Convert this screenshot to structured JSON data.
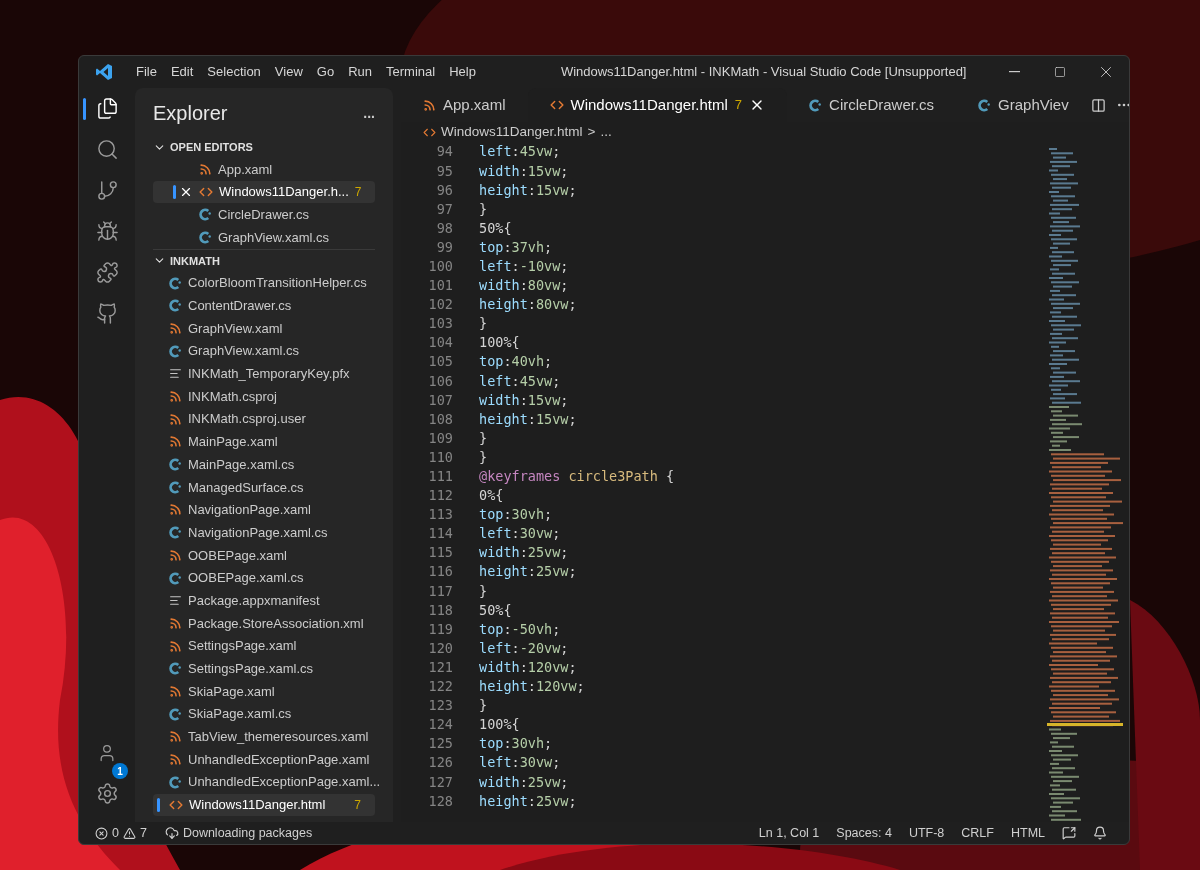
{
  "window": {
    "title": "Windows11Danger.html - INKMath - Visual Studio Code [Unsupported]"
  },
  "menu": [
    "File",
    "Edit",
    "Selection",
    "View",
    "Go",
    "Run",
    "Terminal",
    "Help"
  ],
  "activity_bar": {
    "top": [
      {
        "kind": "files",
        "selected": true
      },
      {
        "kind": "search",
        "selected": false
      },
      {
        "kind": "source-control",
        "selected": false
      },
      {
        "kind": "debug",
        "selected": false
      },
      {
        "kind": "extensions",
        "selected": false
      },
      {
        "kind": "github",
        "selected": false
      }
    ],
    "bottom": [
      {
        "kind": "account",
        "badge": "1"
      },
      {
        "kind": "settings"
      }
    ]
  },
  "sidebar": {
    "title": "Explorer",
    "more": "...",
    "sections": [
      {
        "title": "OPEN EDITORS",
        "expanded": true,
        "items": [
          {
            "name": "App.xaml",
            "kind": "xaml",
            "selected": false
          },
          {
            "name": "Windows11Danger.h...",
            "kind": "html",
            "selected": true,
            "badge": "7"
          },
          {
            "name": "CircleDrawer.cs",
            "kind": "cs",
            "selected": false
          },
          {
            "name": "GraphView.xaml.cs",
            "kind": "cs",
            "selected": false
          }
        ]
      },
      {
        "title": "INKMATH",
        "expanded": true,
        "items": [
          {
            "name": "ColorBloomTransitionHelper.cs",
            "kind": "cs",
            "selected": false
          },
          {
            "name": "ContentDrawer.cs",
            "kind": "cs",
            "selected": false
          },
          {
            "name": "GraphView.xaml",
            "kind": "xaml",
            "selected": false
          },
          {
            "name": "GraphView.xaml.cs",
            "kind": "cs",
            "selected": false
          },
          {
            "name": "INKMath_TemporaryKey.pfx",
            "kind": "text",
            "selected": false
          },
          {
            "name": "INKMath.csproj",
            "kind": "xaml",
            "selected": false
          },
          {
            "name": "INKMath.csproj.user",
            "kind": "xaml",
            "selected": false
          },
          {
            "name": "MainPage.xaml",
            "kind": "xaml",
            "selected": false
          },
          {
            "name": "MainPage.xaml.cs",
            "kind": "cs",
            "selected": false
          },
          {
            "name": "ManagedSurface.cs",
            "kind": "cs",
            "selected": false
          },
          {
            "name": "NavigationPage.xaml",
            "kind": "xaml",
            "selected": false
          },
          {
            "name": "NavigationPage.xaml.cs",
            "kind": "cs",
            "selected": false
          },
          {
            "name": "OOBEPage.xaml",
            "kind": "xaml",
            "selected": false
          },
          {
            "name": "OOBEPage.xaml.cs",
            "kind": "cs",
            "selected": false
          },
          {
            "name": "Package.appxmanifest",
            "kind": "text",
            "selected": false
          },
          {
            "name": "Package.StoreAssociation.xml",
            "kind": "xaml",
            "selected": false
          },
          {
            "name": "SettingsPage.xaml",
            "kind": "xaml",
            "selected": false
          },
          {
            "name": "SettingsPage.xaml.cs",
            "kind": "cs",
            "selected": false
          },
          {
            "name": "SkiaPage.xaml",
            "kind": "xaml",
            "selected": false
          },
          {
            "name": "SkiaPage.xaml.cs",
            "kind": "cs",
            "selected": false
          },
          {
            "name": "TabView_themeresources.xaml",
            "kind": "xaml",
            "selected": false
          },
          {
            "name": "UnhandledExceptionPage.xaml",
            "kind": "xaml",
            "selected": false
          },
          {
            "name": "UnhandledExceptionPage.xaml...",
            "kind": "cs",
            "selected": false
          },
          {
            "name": "Windows11Danger.html",
            "kind": "html",
            "selected": true,
            "badge": "7"
          }
        ]
      }
    ]
  },
  "tabs": [
    {
      "label": "App.xaml",
      "kind": "xaml",
      "selected": false
    },
    {
      "label": "Windows11Danger.html",
      "kind": "html",
      "selected": true,
      "badge": "7"
    },
    {
      "label": "CircleDrawer.cs",
      "kind": "cs",
      "selected": false
    },
    {
      "label": "GraphViev",
      "kind": "cs",
      "selected": false
    }
  ],
  "breadcrumb": {
    "file": "Windows11Danger.html",
    "separator": ">",
    "rest": "..."
  },
  "editor": {
    "lines": [
      {
        "number": "94",
        "tokens": [
          {
            "text": "left",
            "kind": "property"
          },
          {
            "text": ":",
            "kind": "punct"
          },
          {
            "text": "45vw",
            "kind": "value"
          },
          {
            "text": ";",
            "kind": "punct"
          }
        ]
      },
      {
        "number": "95",
        "tokens": [
          {
            "text": "width",
            "kind": "property"
          },
          {
            "text": ":",
            "kind": "punct"
          },
          {
            "text": "15vw",
            "kind": "value"
          },
          {
            "text": ";",
            "kind": "punct"
          }
        ]
      },
      {
        "number": "96",
        "tokens": [
          {
            "text": "height",
            "kind": "property"
          },
          {
            "text": ":",
            "kind": "punct"
          },
          {
            "text": "15vw",
            "kind": "value"
          },
          {
            "text": ";",
            "kind": "punct"
          }
        ]
      },
      {
        "number": "97",
        "tokens": [
          {
            "text": "}",
            "kind": "punct"
          }
        ]
      },
      {
        "number": "98",
        "tokens": [
          {
            "text": "50%{",
            "kind": "punct"
          }
        ]
      },
      {
        "number": "99",
        "tokens": [
          {
            "text": "top",
            "kind": "property"
          },
          {
            "text": ":",
            "kind": "punct"
          },
          {
            "text": "37vh",
            "kind": "value"
          },
          {
            "text": ";",
            "kind": "punct"
          }
        ]
      },
      {
        "number": "100",
        "tokens": [
          {
            "text": "left",
            "kind": "property"
          },
          {
            "text": ":",
            "kind": "punct"
          },
          {
            "text": "-10vw",
            "kind": "value"
          },
          {
            "text": ";",
            "kind": "punct"
          }
        ]
      },
      {
        "number": "101",
        "tokens": [
          {
            "text": "width",
            "kind": "property"
          },
          {
            "text": ":",
            "kind": "punct"
          },
          {
            "text": "80vw",
            "kind": "value"
          },
          {
            "text": ";",
            "kind": "punct"
          }
        ]
      },
      {
        "number": "102",
        "tokens": [
          {
            "text": "height",
            "kind": "property"
          },
          {
            "text": ":",
            "kind": "punct"
          },
          {
            "text": "80vw",
            "kind": "value"
          },
          {
            "text": ";",
            "kind": "punct"
          }
        ]
      },
      {
        "number": "103",
        "tokens": [
          {
            "text": "}",
            "kind": "punct"
          }
        ]
      },
      {
        "number": "104",
        "tokens": [
          {
            "text": "100%{",
            "kind": "punct"
          }
        ]
      },
      {
        "number": "105",
        "tokens": [
          {
            "text": "top",
            "kind": "property"
          },
          {
            "text": ":",
            "kind": "punct"
          },
          {
            "text": "40vh",
            "kind": "value"
          },
          {
            "text": ";",
            "kind": "punct"
          }
        ]
      },
      {
        "number": "106",
        "tokens": [
          {
            "text": "left",
            "kind": "property"
          },
          {
            "text": ":",
            "kind": "punct"
          },
          {
            "text": "45vw",
            "kind": "value"
          },
          {
            "text": ";",
            "kind": "punct"
          }
        ]
      },
      {
        "number": "107",
        "tokens": [
          {
            "text": "width",
            "kind": "property"
          },
          {
            "text": ":",
            "kind": "punct"
          },
          {
            "text": "15vw",
            "kind": "value"
          },
          {
            "text": ";",
            "kind": "punct"
          }
        ]
      },
      {
        "number": "108",
        "tokens": [
          {
            "text": "height",
            "kind": "property"
          },
          {
            "text": ":",
            "kind": "punct"
          },
          {
            "text": "15vw",
            "kind": "value"
          },
          {
            "text": ";",
            "kind": "punct"
          }
        ]
      },
      {
        "number": "109",
        "tokens": [
          {
            "text": "}",
            "kind": "punct"
          }
        ]
      },
      {
        "number": "110",
        "tokens": [
          {
            "text": "}",
            "kind": "punct"
          }
        ]
      },
      {
        "number": "111",
        "tokens": [
          {
            "text": "@keyframes",
            "kind": "keyword"
          },
          {
            "text": " circle3Path",
            "kind": "name"
          },
          {
            "text": " {",
            "kind": "punct"
          }
        ]
      },
      {
        "number": "112",
        "tokens": [
          {
            "text": "0%{",
            "kind": "punct"
          }
        ]
      },
      {
        "number": "113",
        "tokens": [
          {
            "text": "top",
            "kind": "property"
          },
          {
            "text": ":",
            "kind": "punct"
          },
          {
            "text": "30vh",
            "kind": "value"
          },
          {
            "text": ";",
            "kind": "punct"
          }
        ]
      },
      {
        "number": "114",
        "tokens": [
          {
            "text": "left",
            "kind": "property"
          },
          {
            "text": ":",
            "kind": "punct"
          },
          {
            "text": "30vw",
            "kind": "value"
          },
          {
            "text": ";",
            "kind": "punct"
          }
        ]
      },
      {
        "number": "115",
        "tokens": [
          {
            "text": "width",
            "kind": "property"
          },
          {
            "text": ":",
            "kind": "punct"
          },
          {
            "text": "25vw",
            "kind": "value"
          },
          {
            "text": ";",
            "kind": "punct"
          }
        ]
      },
      {
        "number": "116",
        "tokens": [
          {
            "text": "height",
            "kind": "property"
          },
          {
            "text": ":",
            "kind": "punct"
          },
          {
            "text": "25vw",
            "kind": "value"
          },
          {
            "text": ";",
            "kind": "punct"
          }
        ]
      },
      {
        "number": "117",
        "tokens": [
          {
            "text": "}",
            "kind": "punct"
          }
        ]
      },
      {
        "number": "118",
        "tokens": [
          {
            "text": "50%{",
            "kind": "punct"
          }
        ]
      },
      {
        "number": "119",
        "tokens": [
          {
            "text": "top",
            "kind": "property"
          },
          {
            "text": ":",
            "kind": "punct"
          },
          {
            "text": "-50vh",
            "kind": "value"
          },
          {
            "text": ";",
            "kind": "punct"
          }
        ]
      },
      {
        "number": "120",
        "tokens": [
          {
            "text": "left",
            "kind": "property"
          },
          {
            "text": ":",
            "kind": "punct"
          },
          {
            "text": "-20vw",
            "kind": "value"
          },
          {
            "text": ";",
            "kind": "punct"
          }
        ]
      },
      {
        "number": "121",
        "tokens": [
          {
            "text": "width",
            "kind": "property"
          },
          {
            "text": ":",
            "kind": "punct"
          },
          {
            "text": "120vw",
            "kind": "value"
          },
          {
            "text": ";",
            "kind": "punct"
          }
        ]
      },
      {
        "number": "122",
        "tokens": [
          {
            "text": "height",
            "kind": "property"
          },
          {
            "text": ":",
            "kind": "punct"
          },
          {
            "text": "120vw",
            "kind": "value"
          },
          {
            "text": ";",
            "kind": "punct"
          }
        ]
      },
      {
        "number": "123",
        "tokens": [
          {
            "text": "}",
            "kind": "punct"
          }
        ]
      },
      {
        "number": "124",
        "tokens": [
          {
            "text": "100%{",
            "kind": "punct"
          }
        ]
      },
      {
        "number": "125",
        "tokens": [
          {
            "text": "top",
            "kind": "property"
          },
          {
            "text": ":",
            "kind": "punct"
          },
          {
            "text": "30vh",
            "kind": "value"
          },
          {
            "text": ";",
            "kind": "punct"
          }
        ]
      },
      {
        "number": "126",
        "tokens": [
          {
            "text": "left",
            "kind": "property"
          },
          {
            "text": ":",
            "kind": "punct"
          },
          {
            "text": "30vw",
            "kind": "value"
          },
          {
            "text": ";",
            "kind": "punct"
          }
        ]
      },
      {
        "number": "127",
        "tokens": [
          {
            "text": "width",
            "kind": "property"
          },
          {
            "text": ":",
            "kind": "punct"
          },
          {
            "text": "25vw",
            "kind": "value"
          },
          {
            "text": ";",
            "kind": "punct"
          }
        ]
      },
      {
        "number": "128",
        "tokens": [
          {
            "text": "height",
            "kind": "property"
          },
          {
            "text": ":",
            "kind": "punct"
          },
          {
            "text": "25vw",
            "kind": "value"
          },
          {
            "text": ";",
            "kind": "punct"
          }
        ]
      }
    ]
  },
  "status_bar": {
    "errors": "0",
    "warnings": "7",
    "task": "Downloading packages",
    "right": [
      "Ln 1, Col 1",
      "Spaces: 4",
      "UTF-8",
      "CRLF",
      "HTML"
    ]
  }
}
